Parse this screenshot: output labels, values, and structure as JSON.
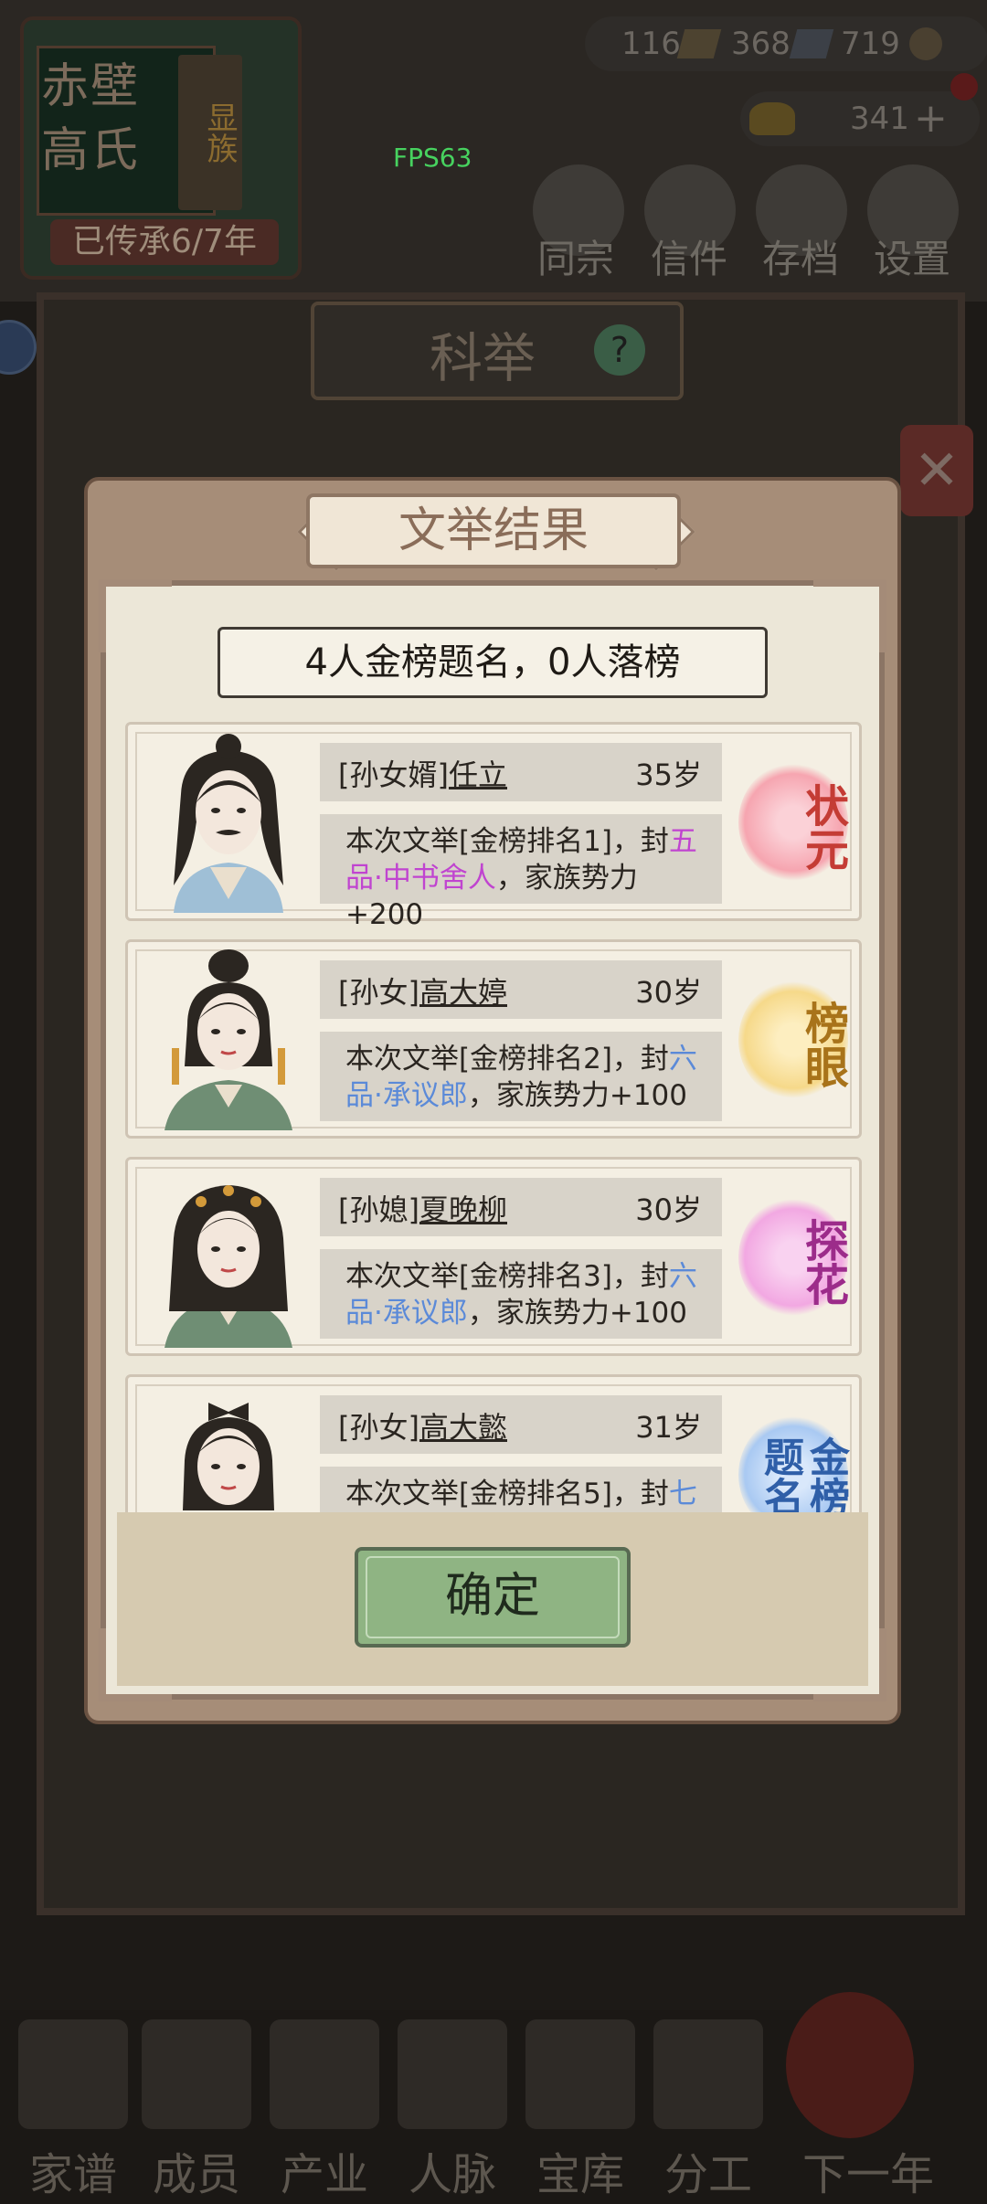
{
  "background": {
    "family": {
      "name": "赤壁高氏",
      "tag": "显族",
      "inherit": "已传承6/7年"
    },
    "currency": {
      "c1": "116",
      "c2": "368",
      "c3": "719",
      "c4": "341"
    },
    "fps": "FPS63",
    "top_nav": [
      "同宗",
      "信件",
      "存档",
      "设置"
    ],
    "hall_title": "科举",
    "help_icon": "?",
    "close_icon": "✕",
    "bottom_nav": [
      "家谱",
      "成员",
      "产业",
      "人脉",
      "宝库",
      "分工",
      "下一年"
    ]
  },
  "dialog": {
    "title": "文举结果",
    "summary": "4人金榜题名，0人落榜",
    "confirm_label": "确定",
    "results": [
      {
        "relation": "[孙女婿]",
        "name": "任立",
        "age": "35岁",
        "desc_prefix": "本次文举[金榜排名1]，封",
        "title": "五品·中书舍人",
        "desc_suffix": "，家族势力+200",
        "rank_label": "状元",
        "rank_color": "#c43c35",
        "rank_glow": "#f6a5b0",
        "title_color": "#c044d0",
        "portrait": "male-scholar-mustache"
      },
      {
        "relation": "[孙女]",
        "name": "高大婷",
        "age": "30岁",
        "desc_prefix": "本次文举[金榜排名2]，封",
        "title": "六品·承议郎",
        "desc_suffix": "，家族势力+100",
        "rank_label": "榜眼",
        "rank_color": "#a8731a",
        "rank_glow": "#f6d98a",
        "title_color": "#5b8ad8",
        "portrait": "female-bun"
      },
      {
        "relation": "[孙媳]",
        "name": "夏晚柳",
        "age": "30岁",
        "desc_prefix": "本次文举[金榜排名3]，封",
        "title": "六品·承议郎",
        "desc_suffix": "，家族势力+100",
        "rank_label": "探花",
        "rank_color": "#9c2c8a",
        "rank_glow": "#f2a8e2",
        "title_color": "#5b8ad8",
        "portrait": "female-hairpins"
      },
      {
        "relation": "[孙女]",
        "name": "高大懿",
        "age": "31岁",
        "desc_prefix": "本次文举[金榜排名5]，封",
        "title": "七",
        "desc_suffix": "",
        "rank_label": "金榜题名",
        "rank_color": "#2f5fa8",
        "rank_glow": "#a9c9f2",
        "title_color": "#5b8ad8",
        "portrait": "female-bow"
      }
    ]
  }
}
